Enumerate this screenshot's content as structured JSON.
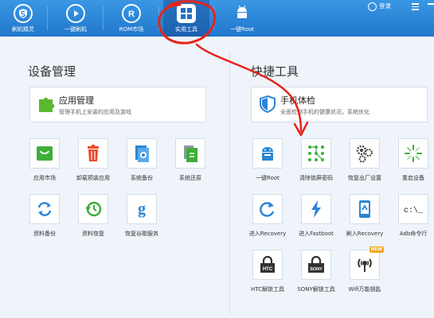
{
  "topbar": {
    "nav": [
      {
        "label": "刷机精灵",
        "icon": "shield-s-icon"
      },
      {
        "label": "一键刷机",
        "icon": "play-icon"
      },
      {
        "label": "ROM市场",
        "icon": "r-icon"
      },
      {
        "label": "实用工具",
        "icon": "grid-icon",
        "active": true
      },
      {
        "label": "一键Root",
        "icon": "android-icon"
      }
    ],
    "login": "登录"
  },
  "left": {
    "title": "设备管理",
    "card": {
      "title": "应用管理",
      "desc": "管理手机上安装的应用及游戏"
    },
    "tiles": [
      {
        "label": "应用市场",
        "icon": "app-market-icon"
      },
      {
        "label": "卸载预装应用",
        "icon": "trash-icon"
      },
      {
        "label": "系统备份",
        "icon": "system-backup-icon"
      },
      {
        "label": "系统还原",
        "icon": "system-restore-icon"
      },
      {
        "label": "资料备份",
        "icon": "data-backup-icon"
      },
      {
        "label": "资料恢复",
        "icon": "data-restore-icon"
      },
      {
        "label": "恢复谷歌服务",
        "icon": "google-icon"
      }
    ]
  },
  "right": {
    "title": "快捷工具",
    "card": {
      "title": "手机体检",
      "desc": "全面检测手机的健康状况，系统优化"
    },
    "tiles": [
      {
        "label": "一键Root",
        "icon": "android-root-icon"
      },
      {
        "label": "清除锁屏密码",
        "icon": "pattern-lock-icon"
      },
      {
        "label": "恢复出厂设置",
        "icon": "gears-icon"
      },
      {
        "label": "重启设备",
        "icon": "reboot-icon"
      },
      {
        "label": "进入Recovery",
        "icon": "recovery-icon"
      },
      {
        "label": "进入Fastboot",
        "icon": "lightning-icon"
      },
      {
        "label": "刷入Recovery",
        "icon": "flash-recovery-icon"
      },
      {
        "label": "Adb命令行",
        "icon": "terminal-icon"
      },
      {
        "label": "HTC解锁工具",
        "icon": "htc-lock-icon"
      },
      {
        "label": "SONY解锁工具",
        "icon": "sony-lock-icon"
      },
      {
        "label": "Wifi万能钥匙",
        "icon": "wifi-key-icon",
        "badge": "NEW"
      }
    ]
  },
  "icon_texts": {
    "g": "g",
    "cmd": "c:\\_",
    "htc": "HTC",
    "sony": "SONY",
    "r": "R"
  },
  "colors": {
    "topbar": "#2b86d8",
    "accent_green": "#3fae3a",
    "accent_blue": "#2a86d4",
    "annotation_red": "#e8231a"
  }
}
